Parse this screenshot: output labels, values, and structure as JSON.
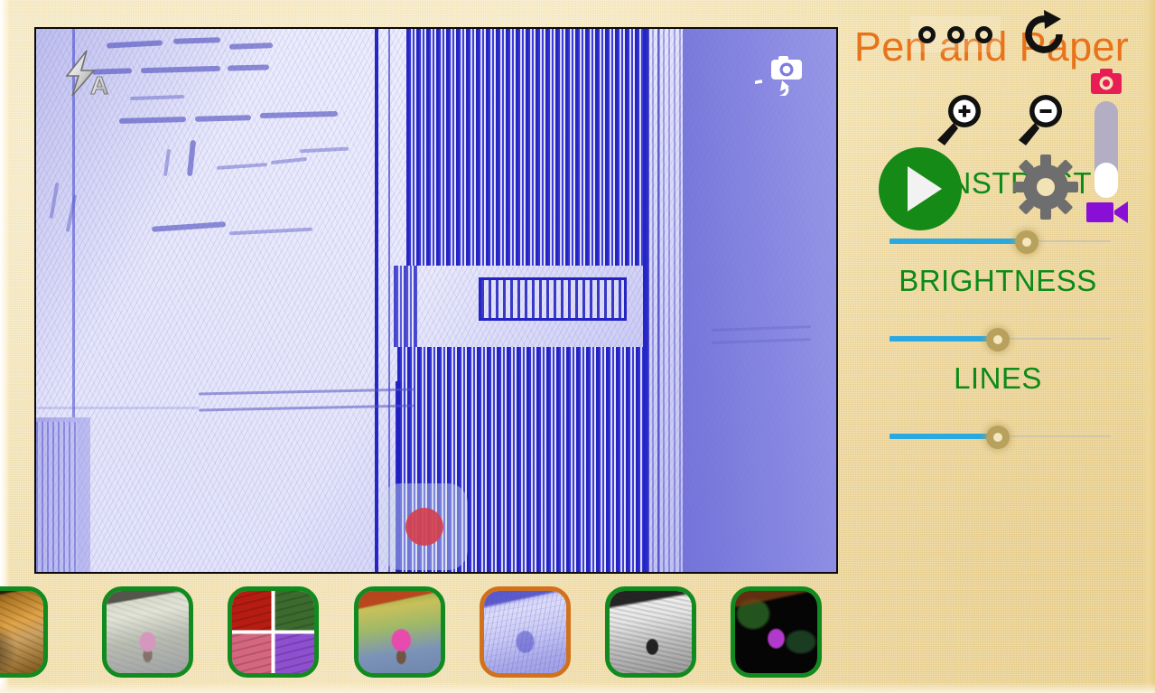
{
  "app": {
    "title": "Pen and Paper",
    "title_color": "#e8731b",
    "background_color": "#f2e0ae"
  },
  "preview": {
    "flash_mode_icon": "flash-auto-icon",
    "flash_mode_label": "A",
    "camera_switch_icon": "camera-switch-icon",
    "record_button_icon": "record-dot-icon",
    "filter_name": "Pen and Paper"
  },
  "zoom_controls": {
    "zoom_in_icon": "magnifier-plus-icon",
    "zoom_out_icon": "magnifier-minus-icon"
  },
  "sliders": [
    {
      "label": "CONSTRAST",
      "name": "contrast",
      "value": 62,
      "min": 0,
      "max": 100,
      "fill_color": "#2aa8e0",
      "thumb_color": "#b8a15c"
    },
    {
      "label": "BRIGHTNESS",
      "name": "brightness",
      "value": 49,
      "min": 0,
      "max": 100,
      "fill_color": "#2aa8e0",
      "thumb_color": "#b8a15c"
    },
    {
      "label": "LINES",
      "name": "lines",
      "value": 49,
      "min": 0,
      "max": 100,
      "fill_color": "#2aa8e0",
      "thumb_color": "#b8a15c"
    }
  ],
  "label_color": "#0d8a18",
  "actions": {
    "overflow_icon": "three-circles-icon",
    "refresh_icon": "refresh-icon",
    "play_icon": "play-icon",
    "play_color": "#168a16",
    "settings_icon": "gear-icon",
    "settings_color": "#6e6e6e"
  },
  "mode_toggle": {
    "photo_icon": "photo-camera-icon",
    "photo_color": "#e81d55",
    "video_icon": "video-camera-icon",
    "video_color": "#8a0fd6",
    "selected_mode": "video",
    "knob_color": "#ffffff",
    "track_color": "#b3aec4"
  },
  "filters": [
    {
      "name": "sepia",
      "selected": false,
      "border_color": "#118a1f",
      "art_class": "art-sepia"
    },
    {
      "name": "pastel",
      "selected": false,
      "border_color": "#118a1f",
      "art_class": "art-pastel"
    },
    {
      "name": "pop-art",
      "selected": false,
      "border_color": "#118a1f",
      "art_class": "art-popart"
    },
    {
      "name": "vivid",
      "selected": false,
      "border_color": "#118a1f",
      "art_class": "art-vivid"
    },
    {
      "name": "pen-and-paper",
      "selected": true,
      "border_color": "#d2711c",
      "art_class": "art-penpaper"
    },
    {
      "name": "grayscale",
      "selected": false,
      "border_color": "#118a1f",
      "art_class": "art-gray"
    },
    {
      "name": "neon-edge",
      "selected": false,
      "border_color": "#118a1f",
      "art_class": "art-neon"
    }
  ]
}
